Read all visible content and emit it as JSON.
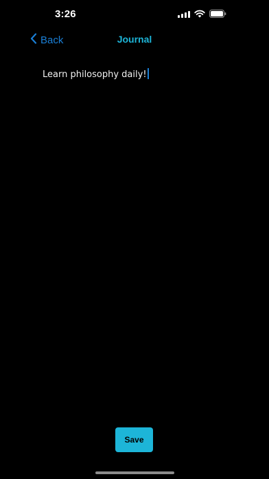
{
  "status_bar": {
    "time": "3:26",
    "icons": [
      "signal-icon",
      "wifi-icon",
      "battery-icon"
    ]
  },
  "nav": {
    "back_label": "Back",
    "back_icon": "chevron-left-icon",
    "title": "Journal"
  },
  "journal": {
    "text": "Learn philosophy daily!"
  },
  "actions": {
    "save_label": "Save"
  },
  "colors": {
    "background": "#000000",
    "accent": "#1db5d8",
    "link": "#1a7fd6",
    "text": "#f2f2f2"
  }
}
